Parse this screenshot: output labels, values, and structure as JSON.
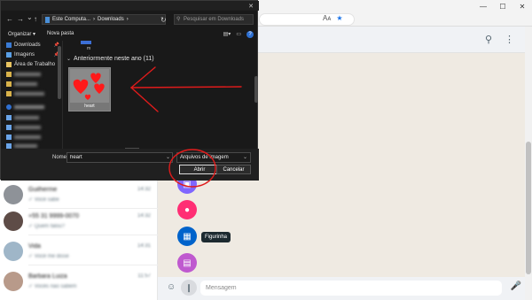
{
  "browser": {
    "window_controls": [
      "—",
      "☐",
      "✕"
    ],
    "read_aloud_icon": "Aᴀ",
    "favorite_icon": "★"
  },
  "whatsapp": {
    "header_icons": [
      "search-icon",
      "menu-icon"
    ],
    "chats": [
      {
        "name": "Guilherme",
        "preview": "✓ Você sabe",
        "time": "14:32"
      },
      {
        "name": "+55 31 9999-0070",
        "preview": "✓ Quem falou?",
        "time": "14:32"
      },
      {
        "name": "Vida",
        "preview": "✓ Você me disse",
        "time": "14:31"
      },
      {
        "name": "Barbara Luiza",
        "preview": "✓ Vocês não sabem",
        "time": "11:57"
      }
    ],
    "attach_tooltip": "Figurinha",
    "attach_colors": {
      "document": "#7f66ff",
      "camera": "#ff2e74",
      "sticker": "#0063cb",
      "photos": "#bf59cf"
    },
    "compose": {
      "placeholder": "Mensagem"
    }
  },
  "dialog": {
    "close_glyph": "✕",
    "nav": {
      "back": "←",
      "forward": "→",
      "recent": "⌄",
      "up": "↑"
    },
    "breadcrumb": [
      "Este Computa...",
      "›",
      "Downloads",
      "›"
    ],
    "refresh_glyph": "↻",
    "search_placeholder": "Pesquisar em Downloads",
    "toolbar": {
      "organize": "Organizar ▾",
      "new_folder": "Nova pasta",
      "help": "?"
    },
    "nav_pane": [
      {
        "label": "Downloads",
        "icon": "download-icon",
        "pinned": true
      },
      {
        "label": "Imagens",
        "icon": "pictures-icon",
        "pinned": true
      },
      {
        "label": "Área de Trabalho",
        "icon": "desktop-icon",
        "pinned": false
      }
    ],
    "group_header": "Anteriormente neste ano (11)",
    "top_item_label": "m",
    "file": {
      "name": "heart"
    },
    "name_label": "Nome:",
    "name_value": "heart",
    "file_type": "Arquivos de imagem",
    "open_label": "Abrir",
    "cancel_label": "Cancelar"
  },
  "colors": {
    "annotation_red": "#e01b1b",
    "accent_blue": "#1a73e8"
  }
}
